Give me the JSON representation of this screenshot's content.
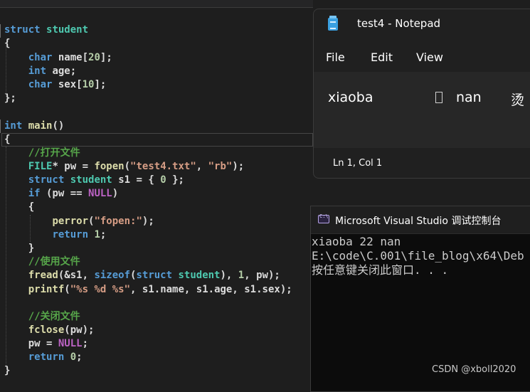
{
  "editor": {
    "lines": [
      {
        "tokens": [
          [
            "kw",
            "struct"
          ],
          [
            "pu",
            " "
          ],
          [
            "ty",
            "student"
          ]
        ]
      },
      {
        "tokens": [
          [
            "pu",
            "{"
          ]
        ]
      },
      {
        "tokens": [
          [
            "pu",
            "    "
          ],
          [
            "kw",
            "char"
          ],
          [
            "pu",
            " "
          ],
          [
            "id",
            "name"
          ],
          [
            "pu",
            "["
          ],
          [
            "num",
            "20"
          ],
          [
            "pu",
            "];"
          ]
        ]
      },
      {
        "tokens": [
          [
            "pu",
            "    "
          ],
          [
            "kw",
            "int"
          ],
          [
            "pu",
            " "
          ],
          [
            "id",
            "age"
          ],
          [
            "pu",
            ";"
          ]
        ]
      },
      {
        "tokens": [
          [
            "pu",
            "    "
          ],
          [
            "kw",
            "char"
          ],
          [
            "pu",
            " "
          ],
          [
            "id",
            "sex"
          ],
          [
            "pu",
            "["
          ],
          [
            "num",
            "10"
          ],
          [
            "pu",
            "];"
          ]
        ]
      },
      {
        "tokens": [
          [
            "pu",
            "};"
          ]
        ]
      },
      {
        "tokens": []
      },
      {
        "tokens": [
          [
            "kw",
            "int"
          ],
          [
            "pu",
            " "
          ],
          [
            "fn",
            "main"
          ],
          [
            "pu",
            "()"
          ]
        ]
      },
      {
        "tokens": [
          [
            "pu",
            "{"
          ]
        ]
      },
      {
        "tokens": [
          [
            "pu",
            "    "
          ],
          [
            "cmt",
            "//打开文件"
          ]
        ]
      },
      {
        "tokens": [
          [
            "pu",
            "    "
          ],
          [
            "ty",
            "FILE"
          ],
          [
            "pu",
            "* "
          ],
          [
            "id",
            "pw"
          ],
          [
            "pu",
            " = "
          ],
          [
            "fn",
            "fopen"
          ],
          [
            "pu",
            "("
          ],
          [
            "str",
            "\"test4.txt\""
          ],
          [
            "pu",
            ", "
          ],
          [
            "str",
            "\"rb\""
          ],
          [
            "pu",
            ");"
          ]
        ]
      },
      {
        "tokens": [
          [
            "pu",
            "    "
          ],
          [
            "kw",
            "struct"
          ],
          [
            "pu",
            " "
          ],
          [
            "ty",
            "student"
          ],
          [
            "pu",
            " "
          ],
          [
            "id",
            "s1"
          ],
          [
            "pu",
            " = { "
          ],
          [
            "num",
            "0"
          ],
          [
            "pu",
            " };"
          ]
        ]
      },
      {
        "tokens": [
          [
            "pu",
            "    "
          ],
          [
            "kw",
            "if"
          ],
          [
            "pu",
            " ("
          ],
          [
            "id",
            "pw"
          ],
          [
            "pu",
            " == "
          ],
          [
            "mac",
            "NULL"
          ],
          [
            "pu",
            ")"
          ]
        ]
      },
      {
        "tokens": [
          [
            "pu",
            "    {"
          ]
        ]
      },
      {
        "tokens": [
          [
            "pu",
            "        "
          ],
          [
            "fn",
            "perror"
          ],
          [
            "pu",
            "("
          ],
          [
            "str",
            "\"fopen:\""
          ],
          [
            "pu",
            ");"
          ]
        ]
      },
      {
        "tokens": [
          [
            "pu",
            "        "
          ],
          [
            "kw",
            "return"
          ],
          [
            "pu",
            " "
          ],
          [
            "num",
            "1"
          ],
          [
            "pu",
            ";"
          ]
        ]
      },
      {
        "tokens": [
          [
            "pu",
            "    }"
          ]
        ]
      },
      {
        "tokens": [
          [
            "pu",
            "    "
          ],
          [
            "cmt",
            "//使用文件"
          ]
        ]
      },
      {
        "tokens": [
          [
            "pu",
            "    "
          ],
          [
            "fn",
            "fread"
          ],
          [
            "pu",
            "(&"
          ],
          [
            "id",
            "s1"
          ],
          [
            "pu",
            ", "
          ],
          [
            "kw",
            "sizeof"
          ],
          [
            "pu",
            "("
          ],
          [
            "kw",
            "struct"
          ],
          [
            "pu",
            " "
          ],
          [
            "ty",
            "student"
          ],
          [
            "pu",
            "), "
          ],
          [
            "num",
            "1"
          ],
          [
            "pu",
            ", "
          ],
          [
            "id",
            "pw"
          ],
          [
            "pu",
            ");"
          ]
        ]
      },
      {
        "tokens": [
          [
            "pu",
            "    "
          ],
          [
            "fn",
            "printf"
          ],
          [
            "pu",
            "("
          ],
          [
            "str",
            "\"%s %d %s\""
          ],
          [
            "pu",
            ", "
          ],
          [
            "id",
            "s1"
          ],
          [
            "pu",
            "."
          ],
          [
            "id",
            "name"
          ],
          [
            "pu",
            ", "
          ],
          [
            "id",
            "s1"
          ],
          [
            "pu",
            "."
          ],
          [
            "id",
            "age"
          ],
          [
            "pu",
            ", "
          ],
          [
            "id",
            "s1"
          ],
          [
            "pu",
            "."
          ],
          [
            "id",
            "sex"
          ],
          [
            "pu",
            ");"
          ]
        ]
      },
      {
        "tokens": []
      },
      {
        "tokens": [
          [
            "pu",
            "    "
          ],
          [
            "cmt",
            "//关闭文件"
          ]
        ]
      },
      {
        "tokens": [
          [
            "pu",
            "    "
          ],
          [
            "fn",
            "fclose"
          ],
          [
            "pu",
            "("
          ],
          [
            "id",
            "pw"
          ],
          [
            "pu",
            ");"
          ]
        ]
      },
      {
        "tokens": [
          [
            "pu",
            "    "
          ],
          [
            "id",
            "pw"
          ],
          [
            "pu",
            " = "
          ],
          [
            "mac",
            "NULL"
          ],
          [
            "pu",
            ";"
          ]
        ]
      },
      {
        "tokens": [
          [
            "pu",
            "    "
          ],
          [
            "kw",
            "return"
          ],
          [
            "pu",
            " "
          ],
          [
            "num",
            "0"
          ],
          [
            "pu",
            ";"
          ]
        ]
      },
      {
        "tokens": [
          [
            "pu",
            "}"
          ]
        ]
      }
    ]
  },
  "notepad": {
    "title": "test4 - Notepad",
    "menu": [
      "File",
      "Edit",
      "View"
    ],
    "content": {
      "word1": "xiaoba",
      "word2": "nan",
      "word3": "烫"
    },
    "status": "Ln 1, Col 1"
  },
  "console": {
    "title": "Microsoft Visual Studio 调试控制台",
    "icon_text": "C:\\",
    "lines": [
      "xiaoba 22 nan",
      "E:\\code\\C.001\\file_blog\\x64\\Deb",
      "按任意键关闭此窗口. . ."
    ]
  },
  "watermark": "CSDN @xboll2020",
  "colors": {
    "keyword": "#569cd6",
    "type": "#4ec9b0",
    "macro": "#bd63c5",
    "string": "#d69d85",
    "comment": "#57a64a",
    "number": "#b5cea8",
    "function": "#dcdcaa"
  }
}
